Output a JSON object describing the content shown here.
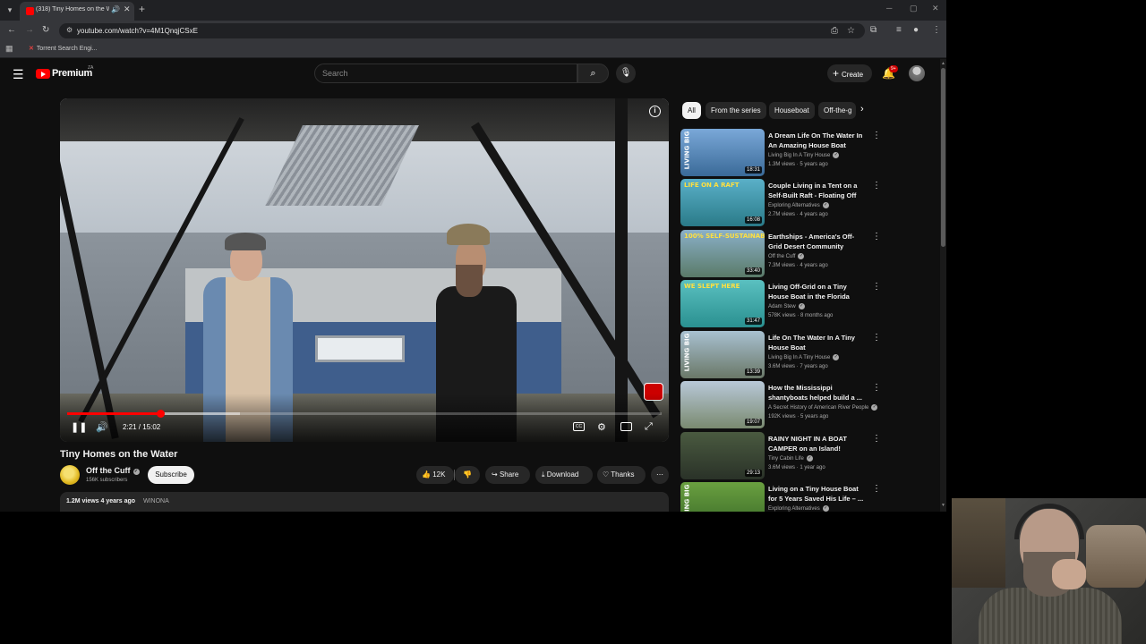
{
  "browser": {
    "tab": {
      "title": "(318) Tiny Homes on the W...",
      "audio_icon": "speaker-icon",
      "close_icon": "close-icon"
    },
    "new_tab_icon": "plus-icon",
    "address": {
      "url": "youtube.com/watch?v=4M1QnqjCSxE"
    },
    "bookmarks": [
      {
        "label": "Torrent Search Engi..."
      }
    ]
  },
  "youtube": {
    "logo_text": "Premium",
    "logo_country": "ZA",
    "search_placeholder": "Search",
    "create_label": "Create",
    "notifications_badge": "9+"
  },
  "player": {
    "time_display": "2:21 / 15:02",
    "progress_fraction": 0.156,
    "buffer_fraction": 0.29
  },
  "video": {
    "title": "Tiny Homes on the Water",
    "channel": "Off the Cuff",
    "subscribers": "156K subscribers",
    "subscribe_label": "Subscribe",
    "likes": "12K",
    "share_label": "Share",
    "download_label": "Download",
    "thanks_label": "Thanks",
    "views_ago": "1.2M views  4 years ago",
    "tag": "WINONA"
  },
  "chips": [
    {
      "label": "All",
      "active": true
    },
    {
      "label": "From the series",
      "active": false
    },
    {
      "label": "Houseboat",
      "active": false
    },
    {
      "label": "Off-the-g",
      "active": false
    }
  ],
  "recommendations": [
    {
      "title": "A Dream Life On The Water In An Amazing House Boat",
      "channel": "Living Big In A Tiny House",
      "meta": "1.3M views · 5 years ago",
      "duration": "18:31",
      "thumb_text": "LIVING BIG",
      "colors": [
        "#7aa8d8",
        "#3a6a98"
      ]
    },
    {
      "title": "Couple Living in a Tent on a Self-Built Raft - Floating Off th...",
      "channel": "Exploring Alternatives",
      "meta": "2.7M views · 4 years ago",
      "duration": "16:08",
      "thumb_text": "LIFE ON A RAFT",
      "colors": [
        "#5ab0c8",
        "#2a7a88"
      ]
    },
    {
      "title": "Earthships - America's Off-Grid Desert Community",
      "channel": "Off the Cuff",
      "meta": "7.3M views · 4 years ago",
      "duration": "33:40",
      "thumb_text": "100% SELF-SUSTAINABLE?",
      "colors": [
        "#8ab0c8",
        "#5a7a68"
      ]
    },
    {
      "title": "Living Off-Grid on a Tiny House Boat in the Florida Keys – 3 ...",
      "channel": "Adam Stew",
      "meta": "578K views · 8 months ago",
      "duration": "31:47",
      "thumb_text": "WE SLEPT HERE",
      "colors": [
        "#5ac0c0",
        "#2a9090"
      ]
    },
    {
      "title": "Life On The Water In A Tiny House Boat",
      "channel": "Living Big In A Tiny House",
      "meta": "3.6M views · 7 years ago",
      "duration": "13:39",
      "thumb_text": "LIVING BIG",
      "colors": [
        "#a8c0d0",
        "#6a7868"
      ]
    },
    {
      "title": "How the Mississippi shantyboats helped build a ...",
      "channel": "A Secret History of American River People",
      "meta": "192K views · 5 years ago",
      "duration": "19:07",
      "thumb_text": "",
      "colors": [
        "#b8c8d8",
        "#7a8a70"
      ]
    },
    {
      "title": "RAINY NIGHT IN A BOAT CAMPER on an Island!",
      "channel": "Tiny Cabin Life",
      "meta": "3.6M views · 1 year ago",
      "duration": "29:13",
      "thumb_text": "",
      "colors": [
        "#4a5a40",
        "#2a3228"
      ]
    },
    {
      "title": "Living on a Tiny House Boat for 5 Years Saved His Life – ...",
      "channel": "Exploring Alternatives",
      "meta": "",
      "duration": "",
      "thumb_text": "LIVING BIG",
      "colors": [
        "#6aa040",
        "#3a6a28"
      ]
    }
  ],
  "webcam": {
    "description": ""
  }
}
